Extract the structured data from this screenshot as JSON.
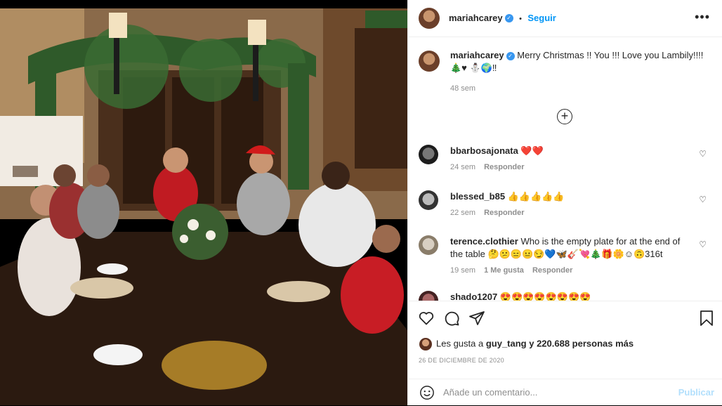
{
  "post": {
    "username": "mariahcarey",
    "verified_mark": "✓",
    "separator": "•",
    "follow_label": "Seguir",
    "more_label": "•••",
    "caption_text": "Merry Christmas !! You !!! Love you Lambily!!!! 🎄♥ ⛄🌍‼",
    "caption_age": "48 sem",
    "load_more_icon": "plus-circle-icon"
  },
  "comments": [
    {
      "user": "bbarbosajonata",
      "text": "❤️❤️",
      "age": "24 sem",
      "likes": "",
      "reply": "Responder"
    },
    {
      "user": "blessed_b85",
      "text": "👍👍👍👍👍",
      "age": "22 sem",
      "likes": "",
      "reply": "Responder"
    },
    {
      "user": "terence.clothier",
      "text": "Who is the empty plate for at the end of the table 🤔😕😑😐😏💙🦋🎸💘🎄🎁🌼☺🙃316t",
      "age": "19 sem",
      "likes": "1 Me gusta",
      "reply": "Responder"
    },
    {
      "user": "shado1207",
      "text": "😍😍😍😍😍😍😍😍",
      "age": "",
      "likes": "",
      "reply": ""
    }
  ],
  "likes": {
    "prefix": "Les gusta a ",
    "user": "guy_tang",
    "suffix": " y 220.688 personas más"
  },
  "date": "26 DE DICIEMBRE DE 2020",
  "add_comment": {
    "placeholder": "Añade un comentario...",
    "publish": "Publicar"
  },
  "colors": {
    "link": "#0095f6",
    "publish_disabled": "#b2dffc",
    "heart_red": "#ed4956"
  }
}
